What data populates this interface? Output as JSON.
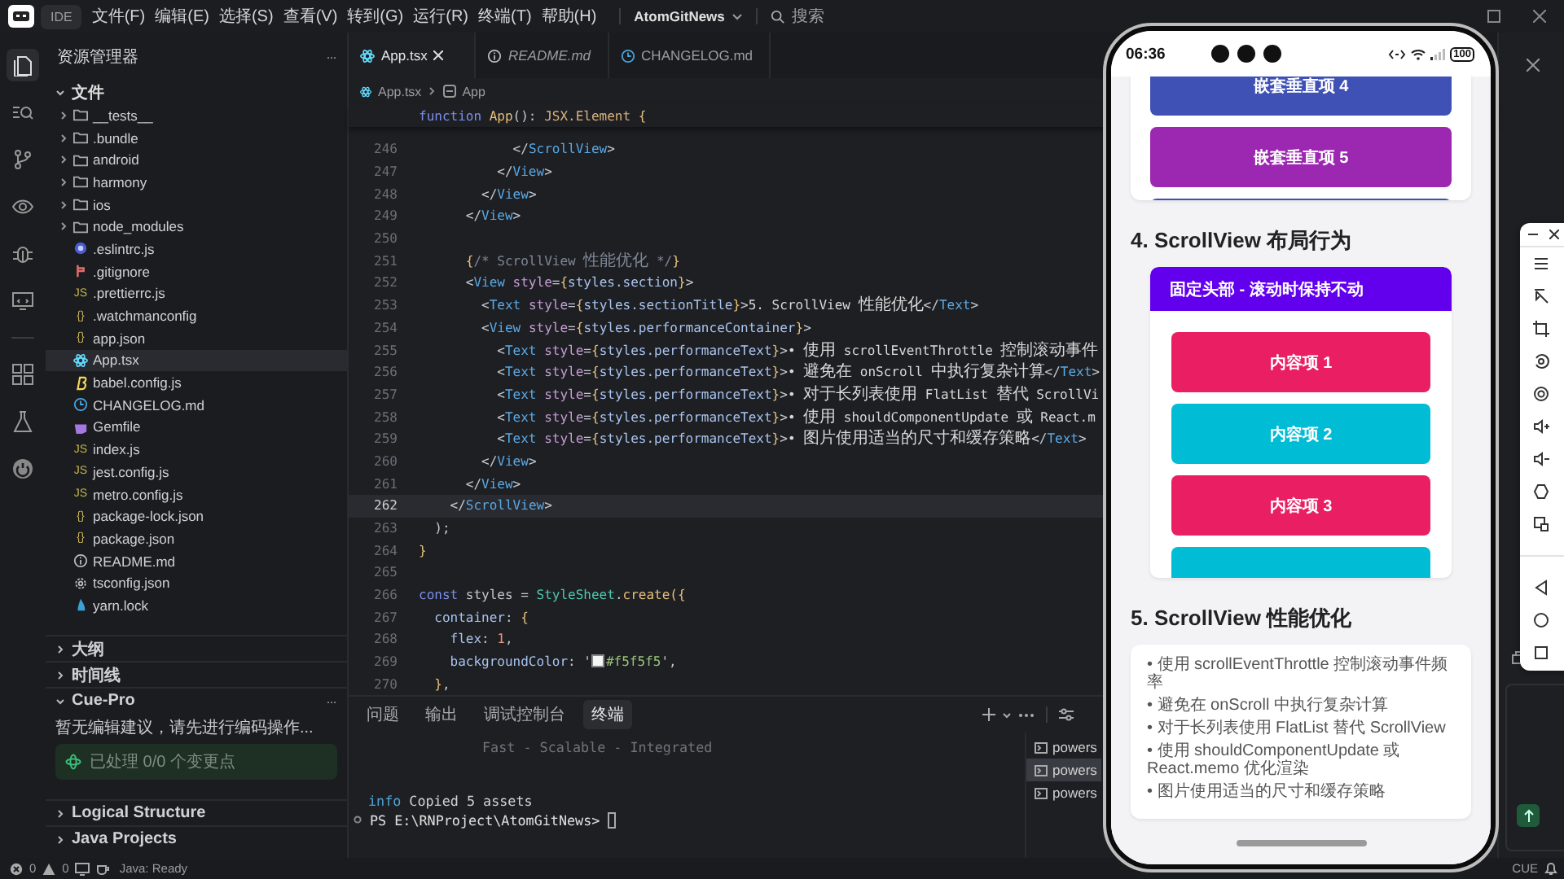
{
  "menubar": {
    "app_badge": "IDE",
    "menus": [
      "文件(F)",
      "编辑(E)",
      "选择(S)",
      "查看(V)",
      "转到(G)",
      "运行(R)",
      "终端(T)",
      "帮助(H)"
    ],
    "project": "AtomGitNews",
    "search_placeholder": "搜索"
  },
  "sidebar": {
    "title": "资源管理器",
    "more": "···",
    "section": {
      "label": "文件",
      "expanded": true
    },
    "files": [
      {
        "name": "__tests__",
        "kind": "folder",
        "selected": false
      },
      {
        "name": ".bundle",
        "kind": "folder",
        "selected": false
      },
      {
        "name": "android",
        "kind": "folder",
        "selected": false
      },
      {
        "name": "harmony",
        "kind": "folder",
        "selected": false
      },
      {
        "name": "ios",
        "kind": "folder",
        "selected": false
      },
      {
        "name": "node_modules",
        "kind": "folder",
        "selected": false
      },
      {
        "name": ".eslintrc.js",
        "kind": "eslint",
        "selected": false
      },
      {
        "name": ".gitignore",
        "kind": "git",
        "selected": false
      },
      {
        "name": ".prettierrc.js",
        "kind": "js",
        "icon_text": "JS",
        "selected": false
      },
      {
        "name": ".watchmanconfig",
        "kind": "json",
        "icon_text": "{}",
        "selected": false
      },
      {
        "name": "app.json",
        "kind": "json",
        "icon_text": "{}",
        "selected": false
      },
      {
        "name": "App.tsx",
        "kind": "react",
        "selected": true
      },
      {
        "name": "babel.config.js",
        "kind": "babel",
        "selected": false
      },
      {
        "name": "CHANGELOG.md",
        "kind": "clock",
        "selected": false
      },
      {
        "name": "Gemfile",
        "kind": "gem",
        "selected": false
      },
      {
        "name": "index.js",
        "kind": "js",
        "icon_text": "JS",
        "selected": false
      },
      {
        "name": "jest.config.js",
        "kind": "js",
        "icon_text": "JS",
        "selected": false
      },
      {
        "name": "metro.config.js",
        "kind": "js",
        "icon_text": "JS",
        "selected": false
      },
      {
        "name": "package-lock.json",
        "kind": "json",
        "icon_text": "{}",
        "selected": false
      },
      {
        "name": "package.json",
        "kind": "json",
        "icon_text": "{}",
        "selected": false
      },
      {
        "name": "README.md",
        "kind": "info",
        "selected": false
      },
      {
        "name": "tsconfig.json",
        "kind": "gear",
        "selected": false
      },
      {
        "name": "yarn.lock",
        "kind": "yarn",
        "selected": false
      }
    ],
    "panels": [
      {
        "label": "大纲",
        "expanded": false
      },
      {
        "label": "时间线",
        "expanded": false
      },
      {
        "label": "Cue-Pro",
        "expanded": true,
        "more": "···",
        "message": "暂无编辑建议，请先进行编码操作...",
        "status": "已处理 0/0 个变更点"
      },
      {
        "label": "Logical Structure",
        "expanded": false
      },
      {
        "label": "Java Projects",
        "expanded": false
      }
    ]
  },
  "editor": {
    "tabs": [
      {
        "label": "App.tsx",
        "kind": "react",
        "selected": true,
        "preview": false
      },
      {
        "label": "README.md",
        "kind": "info",
        "selected": false,
        "preview": true
      },
      {
        "label": "CHANGELOG.md",
        "kind": "clock",
        "selected": false,
        "preview": false
      }
    ],
    "breadcrumb": [
      "App.tsx",
      "App"
    ],
    "sticky": [
      {
        "kind": "kw",
        "text": "function"
      },
      {
        "kind": "fn",
        "text": " App"
      },
      {
        "kind": "p",
        "text": "(): "
      },
      {
        "kind": "type",
        "text": "JSX.Element"
      },
      {
        "kind": "brace",
        "text": " {"
      }
    ],
    "lines": [
      {
        "n": "246",
        "current": false,
        "tokens": [
          {
            "kind": "p",
            "text": "            </"
          },
          {
            "kind": "tag",
            "text": "ScrollView"
          },
          {
            "kind": "p",
            "text": ">"
          }
        ]
      },
      {
        "n": "247",
        "current": false,
        "tokens": [
          {
            "kind": "p",
            "text": "          </"
          },
          {
            "kind": "tag",
            "text": "View"
          },
          {
            "kind": "p",
            "text": ">"
          }
        ]
      },
      {
        "n": "248",
        "current": false,
        "tokens": [
          {
            "kind": "p",
            "text": "        </"
          },
          {
            "kind": "tag",
            "text": "View"
          },
          {
            "kind": "p",
            "text": ">"
          }
        ]
      },
      {
        "n": "249",
        "current": false,
        "tokens": [
          {
            "kind": "p",
            "text": "      </"
          },
          {
            "kind": "tag",
            "text": "View"
          },
          {
            "kind": "p",
            "text": ">"
          }
        ]
      },
      {
        "n": "250",
        "current": false
      },
      {
        "n": "251",
        "current": false,
        "tokens": [
          {
            "kind": "brace",
            "text": "      {"
          },
          {
            "kind": "cm",
            "text": "/* ScrollView 性能优化 */"
          },
          {
            "kind": "brace",
            "text": "}"
          }
        ]
      },
      {
        "n": "252",
        "current": false,
        "tokens": [
          {
            "kind": "p",
            "text": "      <"
          },
          {
            "kind": "tag",
            "text": "View"
          },
          {
            "kind": "attr",
            "text": " style"
          },
          {
            "kind": "p",
            "text": "="
          },
          {
            "kind": "brace",
            "text": "{"
          },
          {
            "kind": "prop",
            "text": "styles.section"
          },
          {
            "kind": "brace",
            "text": "}"
          },
          {
            "kind": "p",
            "text": ">"
          }
        ]
      },
      {
        "n": "253",
        "current": false,
        "tokens": [
          {
            "kind": "p",
            "text": "        <"
          },
          {
            "kind": "tag",
            "text": "Text"
          },
          {
            "kind": "attr",
            "text": " style"
          },
          {
            "kind": "p",
            "text": "="
          },
          {
            "kind": "brace",
            "text": "{"
          },
          {
            "kind": "prop",
            "text": "styles.sectionTitle"
          },
          {
            "kind": "brace",
            "text": "}"
          },
          {
            "kind": "p",
            "text": ">"
          },
          {
            "kind": "txt",
            "text": "5. ScrollView 性能优化"
          },
          {
            "kind": "p",
            "text": "</"
          },
          {
            "kind": "tag",
            "text": "Text"
          },
          {
            "kind": "p",
            "text": ">"
          }
        ]
      },
      {
        "n": "254",
        "current": false,
        "tokens": [
          {
            "kind": "p",
            "text": "        <"
          },
          {
            "kind": "tag",
            "text": "View"
          },
          {
            "kind": "attr",
            "text": " style"
          },
          {
            "kind": "p",
            "text": "="
          },
          {
            "kind": "brace",
            "text": "{"
          },
          {
            "kind": "prop",
            "text": "styles.performanceContainer"
          },
          {
            "kind": "brace",
            "text": "}"
          },
          {
            "kind": "p",
            "text": ">"
          }
        ]
      },
      {
        "n": "255",
        "current": false,
        "tokens": [
          {
            "kind": "p",
            "text": "          <"
          },
          {
            "kind": "tag",
            "text": "Text"
          },
          {
            "kind": "attr",
            "text": " style"
          },
          {
            "kind": "p",
            "text": "="
          },
          {
            "kind": "brace",
            "text": "{"
          },
          {
            "kind": "prop",
            "text": "styles.performanceText"
          },
          {
            "kind": "brace",
            "text": "}"
          },
          {
            "kind": "p",
            "text": ">"
          },
          {
            "kind": "txt",
            "text": "• 使用 scrollEventThrottle 控制滚动事件"
          }
        ]
      },
      {
        "n": "256",
        "current": false,
        "tokens": [
          {
            "kind": "p",
            "text": "          <"
          },
          {
            "kind": "tag",
            "text": "Text"
          },
          {
            "kind": "attr",
            "text": " style"
          },
          {
            "kind": "p",
            "text": "="
          },
          {
            "kind": "brace",
            "text": "{"
          },
          {
            "kind": "prop",
            "text": "styles.performanceText"
          },
          {
            "kind": "brace",
            "text": "}"
          },
          {
            "kind": "p",
            "text": ">"
          },
          {
            "kind": "txt",
            "text": "• 避免在 onScroll 中执行复杂计算"
          },
          {
            "kind": "p",
            "text": "</"
          },
          {
            "kind": "tag",
            "text": "Text"
          },
          {
            "kind": "p",
            "text": ">"
          }
        ]
      },
      {
        "n": "257",
        "current": false,
        "tokens": [
          {
            "kind": "p",
            "text": "          <"
          },
          {
            "kind": "tag",
            "text": "Text"
          },
          {
            "kind": "attr",
            "text": " style"
          },
          {
            "kind": "p",
            "text": "="
          },
          {
            "kind": "brace",
            "text": "{"
          },
          {
            "kind": "prop",
            "text": "styles.performanceText"
          },
          {
            "kind": "brace",
            "text": "}"
          },
          {
            "kind": "p",
            "text": ">"
          },
          {
            "kind": "txt",
            "text": "• 对于长列表使用 FlatList 替代 ScrollVi"
          }
        ]
      },
      {
        "n": "258",
        "current": false,
        "tokens": [
          {
            "kind": "p",
            "text": "          <"
          },
          {
            "kind": "tag",
            "text": "Text"
          },
          {
            "kind": "attr",
            "text": " style"
          },
          {
            "kind": "p",
            "text": "="
          },
          {
            "kind": "brace",
            "text": "{"
          },
          {
            "kind": "prop",
            "text": "styles.performanceText"
          },
          {
            "kind": "brace",
            "text": "}"
          },
          {
            "kind": "p",
            "text": ">"
          },
          {
            "kind": "txt",
            "text": "• 使用 shouldComponentUpdate 或 React.m"
          }
        ]
      },
      {
        "n": "259",
        "current": false,
        "tokens": [
          {
            "kind": "p",
            "text": "          <"
          },
          {
            "kind": "tag",
            "text": "Text"
          },
          {
            "kind": "attr",
            "text": " style"
          },
          {
            "kind": "p",
            "text": "="
          },
          {
            "kind": "brace",
            "text": "{"
          },
          {
            "kind": "prop",
            "text": "styles.performanceText"
          },
          {
            "kind": "brace",
            "text": "}"
          },
          {
            "kind": "p",
            "text": ">"
          },
          {
            "kind": "txt",
            "text": "• 图片使用适当的尺寸和缓存策略"
          },
          {
            "kind": "p",
            "text": "</"
          },
          {
            "kind": "tag",
            "text": "Text"
          },
          {
            "kind": "p",
            "text": ">"
          }
        ]
      },
      {
        "n": "260",
        "current": false,
        "tokens": [
          {
            "kind": "p",
            "text": "        </"
          },
          {
            "kind": "tag",
            "text": "View"
          },
          {
            "kind": "p",
            "text": ">"
          }
        ]
      },
      {
        "n": "261",
        "current": false,
        "tokens": [
          {
            "kind": "p",
            "text": "      </"
          },
          {
            "kind": "tag",
            "text": "View"
          },
          {
            "kind": "p",
            "text": ">"
          }
        ]
      },
      {
        "n": "262",
        "current": true,
        "tokens": [
          {
            "kind": "p",
            "text": "    </"
          },
          {
            "kind": "tag",
            "text": "ScrollView"
          },
          {
            "kind": "p",
            "text": ">"
          }
        ]
      },
      {
        "n": "263",
        "current": false,
        "tokens": [
          {
            "kind": "p",
            "text": "  );"
          }
        ]
      },
      {
        "n": "264",
        "current": false,
        "tokens": [
          {
            "kind": "brace",
            "text": "}"
          }
        ]
      },
      {
        "n": "265",
        "current": false
      },
      {
        "n": "266",
        "current": false,
        "tokens": [
          {
            "kind": "kw",
            "text": "const"
          },
          {
            "kind": "var",
            "text": " styles"
          },
          {
            "kind": "p",
            "text": " = "
          },
          {
            "kind": "cls",
            "text": "StyleSheet"
          },
          {
            "kind": "p",
            "text": "."
          },
          {
            "kind": "fn",
            "text": "create"
          },
          {
            "kind": "brace",
            "text": "({"
          }
        ]
      },
      {
        "n": "267",
        "current": false,
        "tokens": [
          {
            "kind": "prop",
            "text": "  container"
          },
          {
            "kind": "p",
            "text": ": "
          },
          {
            "kind": "brace",
            "text": "{"
          }
        ]
      },
      {
        "n": "268",
        "current": false,
        "tokens": [
          {
            "kind": "prop",
            "text": "    flex"
          },
          {
            "kind": "p",
            "text": ": "
          },
          {
            "kind": "num",
            "text": "1"
          },
          {
            "kind": "p",
            "text": ","
          }
        ]
      },
      {
        "n": "269",
        "current": false,
        "tokens": [
          {
            "kind": "prop",
            "text": "    backgroundColor"
          },
          {
            "kind": "p",
            "text": ": '"
          },
          {
            "kind": "color",
            "text": "#f5f5f5"
          },
          {
            "kind": "p",
            "text": "',"
          }
        ]
      },
      {
        "n": "270",
        "current": false,
        "tokens": [
          {
            "kind": "brace",
            "text": "  }"
          },
          {
            "kind": "p",
            "text": ","
          }
        ]
      }
    ]
  },
  "panel": {
    "tabs": [
      {
        "label": "问题",
        "selected": false
      },
      {
        "label": "输出",
        "selected": false
      },
      {
        "label": "调试控制台",
        "selected": false
      },
      {
        "label": "终端",
        "selected": true
      }
    ],
    "terminal": [
      {
        "kind": "dim",
        "text": "Fast - Scalable - Integrated"
      },
      {
        "kind": "log",
        "tag": "info",
        "text": "Copied 5 assets"
      },
      {
        "kind": "prompt",
        "text": "PS E:\\RNProject\\AtomGitNews>"
      }
    ],
    "sessions": [
      {
        "label": "powers",
        "selected": false
      },
      {
        "label": "powers",
        "selected": true
      },
      {
        "label": "powers",
        "selected": false
      }
    ]
  },
  "phone": {
    "time": "06:36",
    "battery": "100",
    "nested_items": [
      {
        "label": "嵌套垂直项 4",
        "color": "#3f51b5"
      },
      {
        "label": "嵌套垂直项 5",
        "color": "#9c27b0"
      },
      {
        "color": "#3f51b5"
      }
    ],
    "layout_section": {
      "title": "4. ScrollView 布局行为",
      "header": "固定头部 - 滚动时保持不动",
      "items": [
        {
          "label": "内容项 1",
          "color": "#e91e63"
        },
        {
          "label": "内容项 2",
          "color": "#00bcd4"
        },
        {
          "label": "内容项 3",
          "color": "#e91e63"
        },
        {
          "color": "#00bcd4"
        }
      ]
    },
    "perf_section": {
      "title": "5. ScrollView 性能优化",
      "tips": [
        "• 使用 scrollEventThrottle 控制滚动事件频率",
        "• 避免在 onScroll 中执行复杂计算",
        "• 对于长列表使用 FlatList 替代 ScrollView",
        "• 使用 shouldComponentUpdate 或 React.memo 优化渲染",
        "• 图片使用适当的尺寸和缓存策略"
      ]
    }
  },
  "status_bar": {
    "errors": "0",
    "warnings": "0",
    "java": "Java: Ready",
    "cue": "CUE"
  }
}
